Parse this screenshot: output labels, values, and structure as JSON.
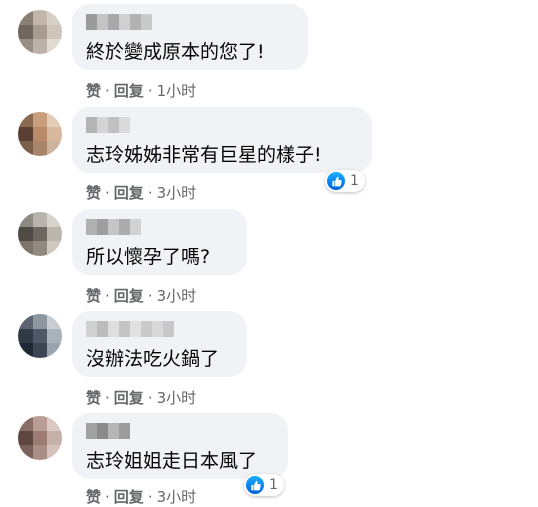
{
  "labels": {
    "like": "赞",
    "reply": "回复",
    "sep": "·"
  },
  "colors": {
    "bubble": "#f0f2f5",
    "like": "#1877f2",
    "meta": "#65676b"
  },
  "comments": [
    {
      "text": "終於變成原本的您了!",
      "time": "1小时",
      "reactions": null
    },
    {
      "text": "志玲姊姊非常有巨星的樣子!",
      "time": "3小时",
      "reactions": "1"
    },
    {
      "text": "所以懷孕了嗎?",
      "time": "3小时",
      "reactions": null
    },
    {
      "text": "沒辦法吃火鍋了",
      "time": "3小时",
      "reactions": null
    },
    {
      "text": "志玲姐姐走日本風了",
      "time": "3小时",
      "reactions": "1"
    }
  ]
}
